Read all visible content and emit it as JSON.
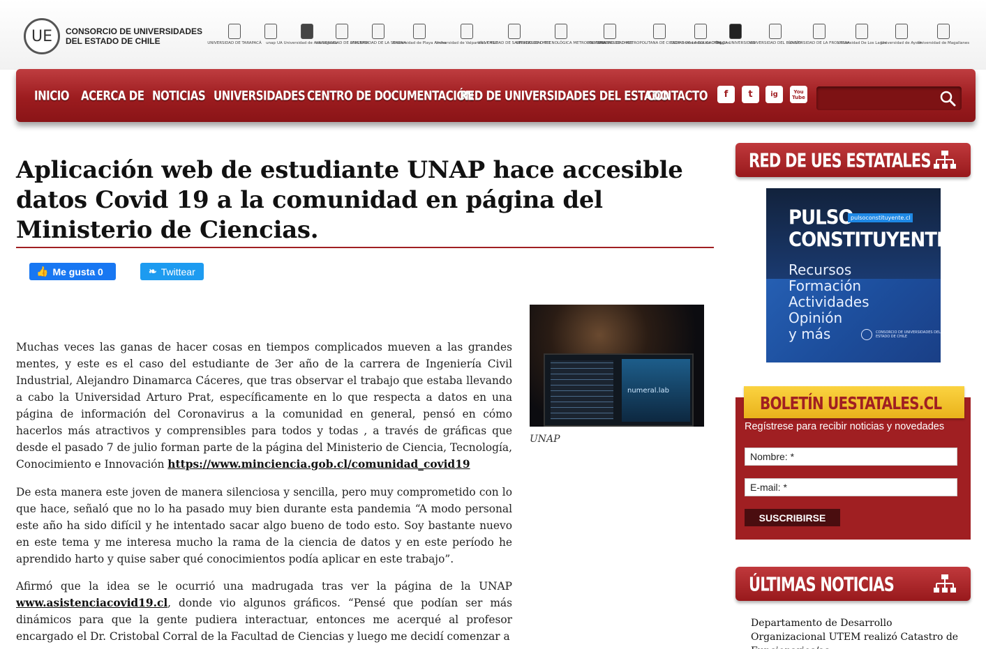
{
  "header": {
    "logo_mark": "UE",
    "logo_line1": "CONSORCIO DE UNIVERSIDADES",
    "logo_line2": "DEL ESTADO DE CHILE",
    "universities": [
      "UNIVERSIDAD DE TARAPACÁ",
      "unap",
      "UA Universidad de Antofagasta",
      "UNIVERSIDAD DE ATACAMA",
      "UNIVERSIDAD DE LA SERENA",
      "Universidad de Playa Ancha",
      "Universidad de Valparaíso CHILE",
      "UNIVERSIDAD DE SANTIAGO DE CHILE",
      "UNIVERSIDAD TECNOLÓGICA METROPOLITANA",
      "UNIVERSIDAD DE CHILE",
      "UNIVERSIDAD METROPOLITANA DE CIENCIAS DE LA EDUCACIÓN",
      "UOH Universidad de O'Higgins",
      "TALCA UNIVERSIDAD",
      "UNIVERSIDAD DEL BÍO-BÍO",
      "UNIVERSIDAD DE LA FRONTERA",
      "Universidad De Los Lagos",
      "Universidad de Aysén",
      "Universidad de Magallanes"
    ]
  },
  "nav": {
    "items": [
      "INICIO",
      "ACERCA DE",
      "NOTICIAS",
      "UNIVERSIDADES",
      "CENTRO DE DOCUMENTACIÓN",
      "RED DE UNIVERSIDADES DEL ESTADO",
      "CONTACTO"
    ],
    "social": [
      "f",
      "t",
      "ig",
      "You Tube"
    ],
    "search_placeholder": ""
  },
  "article": {
    "title": "Aplicación web de estudiante UNAP hace accesible datos Covid 19 a la comunidad en página del Ministerio de Ciencias.",
    "like_label": "Me gusta 0",
    "tweet_label": "Twittear",
    "photo_brand": "numeral.lab",
    "caption": "UNAP",
    "p1_text": "Muchas veces las ganas de hacer cosas en tiempos complicados mueven a las grandes mentes, y este es el caso del estudiante de 3er año de la carrera de Ingeniería Civil Industrial, Alejandro Dinamarca Cáceres, que tras observar el trabajo que estaba llevando a cabo la Universidad Arturo Prat, específicamente en lo que respecta a datos en una página de información del Coronavirus a la comunidad en general, pensó en cómo hacerlos más atractivos y comprensibles para todos y todas , a través de gráficas que desde el pasado 7 de julio  forman parte de la página del Ministerio de Ciencia, Tecnología, Conocimiento e Innovación ",
    "p1_link": "https://www.minciencia.gob.cl/comunidad_covid19",
    "p2_text": "De esta manera este joven de manera silenciosa y sencilla, pero muy comprometido con lo que hace, señaló que no lo ha pasado muy bien durante esta pandemia “A modo personal este año ha sido difícil y he intentado sacar algo bueno de todo esto. Soy bastante nuevo en este tema y me interesa mucho la rama de la ciencia de datos y en este período he aprendido harto y quise saber  qué conocimientos podía aplicar en este trabajo”.",
    "p3_text_a": "Afirmó que la idea se le ocurrió una madrugada tras ver la página de la UNAP ",
    "p3_link": "www.asistenciacovid19.cl",
    "p3_text_b": ", donde vio algunos gráficos.  “Pensé que podían ser más dinámicos para que la gente pudiera interactuar, entonces me acerqué al profesor encargado el Dr. Cristobal Corral de la Facultad de Ciencias y luego me decidí comenzar a"
  },
  "sidebar": {
    "red_title": "RED DE UES ESTATALES",
    "banner": {
      "line1": "PULSO",
      "line2": "CONSTITUYENTE",
      "url": "pulsoconstituyente.cl",
      "items": [
        "Recursos",
        "Formación",
        "Actividades",
        "Opinión",
        "y más"
      ],
      "mini_text": "CONSORCIO DE UNIVERSIDADES DEL ESTADO DE CHILE"
    },
    "newsletter": {
      "title": "BOLETÍN UESTATALES.CL",
      "subtitle": "Regístrese para recibir noticias y novedades",
      "name_placeholder": "Nombre: *",
      "email_placeholder": "E-mail: *",
      "subscribe_label": "SUSCRIBIRSE"
    },
    "latest_title": "ÚLTIMAS NOTICIAS",
    "latest_first": "Departamento de Desarrollo Organizacional UTEM realizó Catastro de Funcionarios/as"
  },
  "colors": {
    "brand_red": "#a01f22",
    "ribbon_yellow": "#f4c430",
    "link_blue": "#1877f2"
  }
}
